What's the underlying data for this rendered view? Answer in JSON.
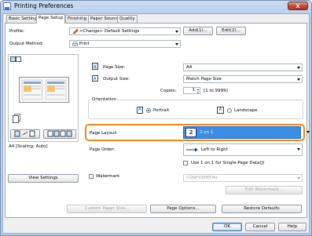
{
  "window": {
    "title": "Printing Preferences",
    "close_glyph": "x"
  },
  "tabs": [
    {
      "label": "Basic Settings"
    },
    {
      "label": "Page Setup"
    },
    {
      "label": "Finishing"
    },
    {
      "label": "Paper Source"
    },
    {
      "label": "Quality"
    }
  ],
  "profile": {
    "label": "Profile:",
    "value": "<Change> Default Settings",
    "add_label": "Add(1)...",
    "edit_label": "Edit(2)..."
  },
  "output_method": {
    "label": "Output Method:",
    "value": "Print"
  },
  "page_size": {
    "label": "Page Size:",
    "value": "A4"
  },
  "output_size": {
    "label": "Output Size:",
    "value": "Match Page Size"
  },
  "copies": {
    "label": "Copies:",
    "value": "1",
    "range": "[1 to 9999]"
  },
  "orientation": {
    "label": "Orientation",
    "portrait": "Portrait",
    "landscape": "Landscape",
    "icon_letter": "A"
  },
  "page_layout": {
    "label": "Page Layout:",
    "value": "2 on 1",
    "icon_number": "2"
  },
  "page_order": {
    "label": "Page Order:",
    "value": "Left to Right"
  },
  "single_page_data": {
    "label": "Use 1 on 1 for Single-Page Data(J)"
  },
  "preview_caption": "A4 [Scaling: Auto]",
  "view_settings_label": "View Settings",
  "watermark": {
    "label": "Watermark",
    "value": "CONFIDENTIAL",
    "edit_label": "Edit Watermark..."
  },
  "bottom_buttons": {
    "custom_paper_size": "Custom Paper Size...",
    "page_options": "Page Options...",
    "restore_defaults": "Restore Defaults"
  },
  "dialog_buttons": {
    "ok": "OK",
    "cancel": "Cancel",
    "help": "Help"
  },
  "colors": {
    "highlight": "#f0891a",
    "selected_combo": "#3a8ee6"
  }
}
